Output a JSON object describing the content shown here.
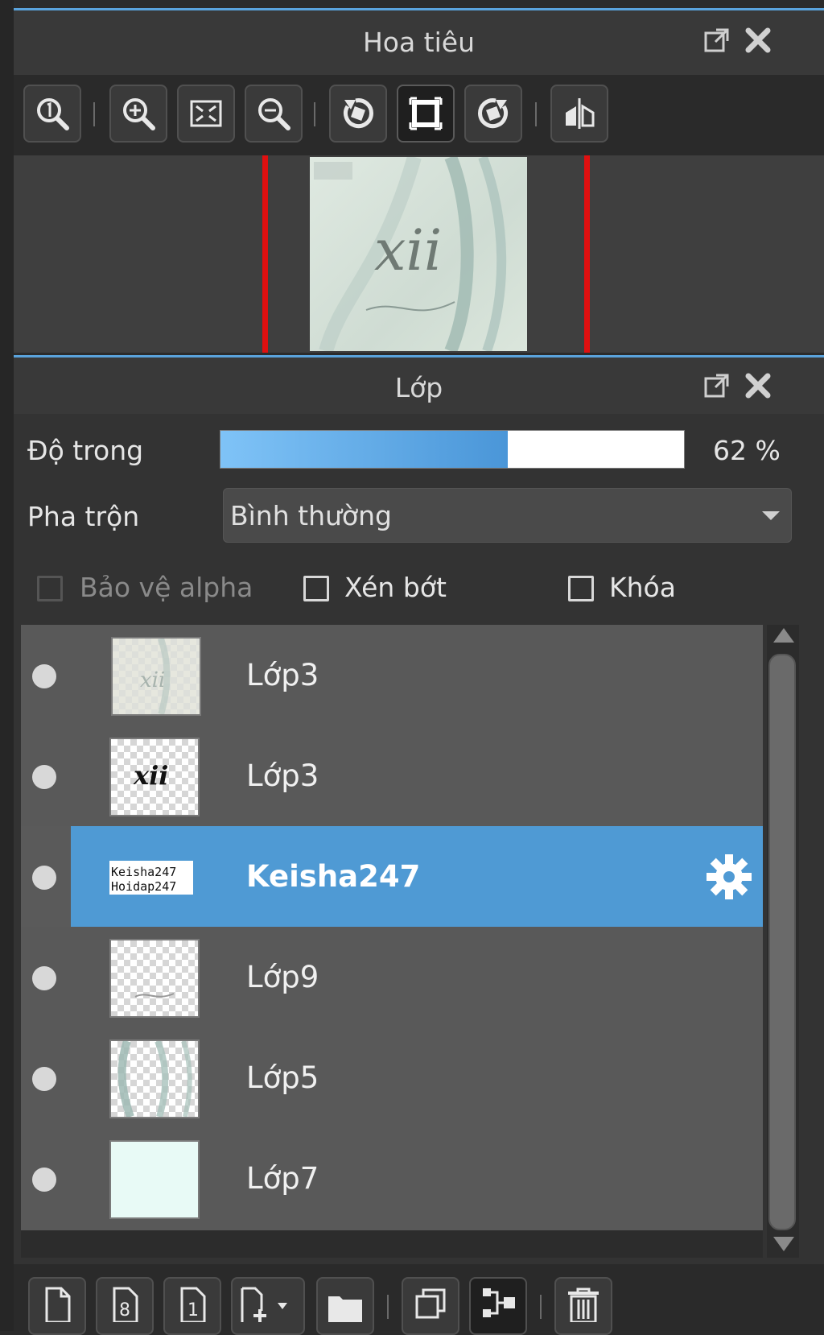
{
  "navigator": {
    "title": "Hoa tiêu",
    "toolbar": [
      {
        "name": "zoom-100-icon"
      },
      {
        "name": "zoom-in-icon"
      },
      {
        "name": "fit-window-icon"
      },
      {
        "name": "zoom-out-icon"
      },
      {
        "name": "rotate-left-icon"
      },
      {
        "name": "reset-rotation-icon"
      },
      {
        "name": "rotate-right-icon"
      },
      {
        "name": "flip-horizontal-icon"
      }
    ],
    "thumbnail_text": "xii"
  },
  "layers_panel": {
    "title": "Lớp",
    "opacity_label": "Độ trong",
    "opacity_value": "62 %",
    "opacity_fraction": 0.62,
    "blend_label": "Pha trộn",
    "blend_value": "Bình thường",
    "checkboxes": {
      "protect_alpha": {
        "label": "Bảo vệ alpha",
        "checked": false,
        "enabled": false
      },
      "clipping": {
        "label": "Xén bớt",
        "checked": false,
        "enabled": true
      },
      "lock": {
        "label": "Khóa",
        "checked": false,
        "enabled": true
      }
    },
    "layers": [
      {
        "name": "Lớp3",
        "selected": false
      },
      {
        "name": "Lớp3",
        "selected": false,
        "thumb_text": "xii"
      },
      {
        "name": "Keisha247",
        "selected": true,
        "thumb_text": "Keisha247"
      },
      {
        "name": "Lớp9",
        "selected": false
      },
      {
        "name": "Lớp5",
        "selected": false
      },
      {
        "name": "Lớp7",
        "selected": false
      }
    ],
    "bottom_toolbar": [
      {
        "name": "new-layer-icon"
      },
      {
        "name": "new-8bit-layer-icon",
        "glyph": "8"
      },
      {
        "name": "new-1bit-layer-icon",
        "glyph": "1"
      },
      {
        "name": "add-layer-menu-icon"
      },
      {
        "name": "folder-icon"
      },
      {
        "name": "duplicate-layer-icon"
      },
      {
        "name": "merge-down-icon"
      },
      {
        "name": "delete-layer-icon"
      }
    ]
  },
  "colors": {
    "accent": "#4f9ad4",
    "panel_bg": "#333333",
    "row_bg": "#595959",
    "nav_border": "#e01010"
  }
}
